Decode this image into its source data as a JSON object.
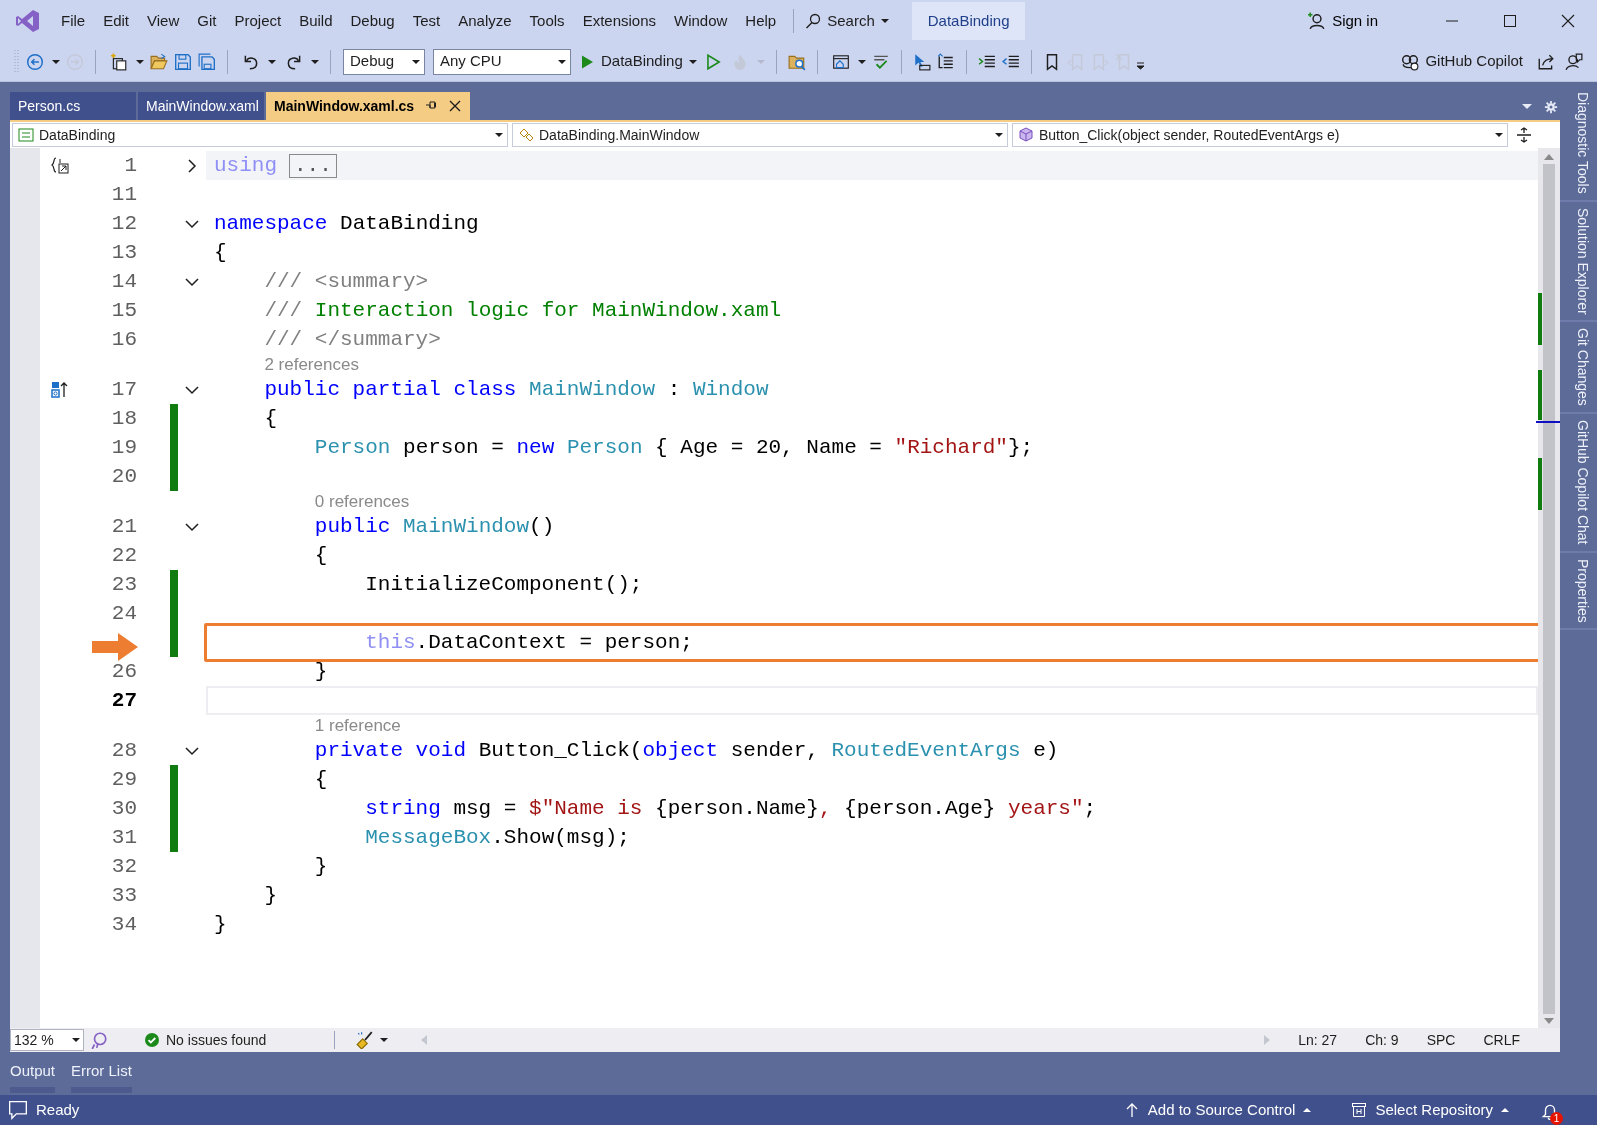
{
  "menu": [
    "File",
    "Edit",
    "View",
    "Git",
    "Project",
    "Build",
    "Debug",
    "Test",
    "Analyze",
    "Tools",
    "Extensions",
    "Window",
    "Help"
  ],
  "search": {
    "label": "Search"
  },
  "solution_title": "DataBinding",
  "sign_in": "Sign in",
  "toolbar": [
    {
      "kind": "back",
      "disabled": false
    },
    {
      "kind": "forward",
      "disabled": true
    },
    {
      "kind": "sep"
    },
    {
      "kind": "new-item",
      "disabled": false
    },
    {
      "kind": "open",
      "disabled": false
    },
    {
      "kind": "save",
      "disabled": false
    },
    {
      "kind": "save-all",
      "disabled": false
    },
    {
      "kind": "sep"
    },
    {
      "kind": "undo",
      "disabled": false
    },
    {
      "kind": "redo",
      "disabled": false
    },
    {
      "kind": "sep"
    },
    {
      "kind": "combo",
      "value": "Debug"
    },
    {
      "kind": "combo",
      "value": "Any CPU"
    },
    {
      "kind": "run",
      "label": "DataBinding"
    },
    {
      "kind": "run-outline",
      "disabled": false
    },
    {
      "kind": "hot-reload",
      "disabled": true
    },
    {
      "kind": "sep"
    },
    {
      "kind": "folder-search",
      "disabled": false
    },
    {
      "kind": "sep"
    },
    {
      "kind": "window",
      "disabled": false
    },
    {
      "kind": "spell",
      "disabled": false
    },
    {
      "kind": "sep"
    },
    {
      "kind": "cursor",
      "disabled": false
    },
    {
      "kind": "member-list",
      "disabled": false
    },
    {
      "kind": "sep"
    },
    {
      "kind": "indent",
      "disabled": false
    },
    {
      "kind": "outdent",
      "disabled": false
    },
    {
      "kind": "sep"
    },
    {
      "kind": "bookmark",
      "disabled": false
    },
    {
      "kind": "bookmark-prev",
      "disabled": true
    },
    {
      "kind": "bookmark-next",
      "disabled": true
    },
    {
      "kind": "bookmark-clear",
      "disabled": true
    },
    {
      "kind": "overflow"
    }
  ],
  "copilot": "GitHub Copilot",
  "tabs": [
    {
      "label": "Person.cs",
      "selected": false
    },
    {
      "label": "MainWindow.xaml",
      "selected": false
    },
    {
      "label": "MainWindow.xaml.cs",
      "selected": true
    }
  ],
  "nav_bar": {
    "project": "DataBinding",
    "type": "DataBinding.MainWindow",
    "member": "Button_Click(object sender, RoutedEventArgs e)"
  },
  "lines": [
    {
      "kind": "collapsed-usings",
      "number": "1",
      "expanded": false,
      "tokens": [
        {
          "text": "using",
          "kind": "dim"
        },
        {
          "text": "...",
          "kind": "fold-box"
        }
      ]
    },
    {
      "kind": "code",
      "number": "11"
    },
    {
      "kind": "code",
      "number": "12",
      "expanded": true,
      "tokens": [
        {
          "text": "namespace ",
          "kind": "keyword"
        },
        {
          "text": "DataBinding",
          "kind": "plain"
        }
      ]
    },
    {
      "kind": "code",
      "number": "13",
      "tokens": [
        {
          "text": "{",
          "kind": "plain"
        }
      ],
      "children": [
        {
          "kind": "code",
          "number": "14",
          "expanded": true,
          "tokens": [
            {
              "text": "/// <summary>",
              "kind": "doc"
            }
          ]
        },
        {
          "kind": "code",
          "number": "15",
          "tokens": [
            {
              "text": "/// ",
              "kind": "doc"
            },
            {
              "text": "Interaction logic for MainWindow.xaml",
              "kind": "comment"
            }
          ]
        },
        {
          "kind": "code",
          "number": "16",
          "tokens": [
            {
              "text": "/// </summary>",
              "kind": "doc"
            }
          ]
        },
        {
          "kind": "class-declaration",
          "codelens": "2 references",
          "number": "17",
          "expanded": true,
          "tokens": [
            {
              "text": "public partial class ",
              "kind": "keyword"
            },
            {
              "text": "MainWindow",
              "kind": "type"
            },
            {
              "text": " : ",
              "kind": "plain"
            },
            {
              "text": "Window",
              "kind": "type"
            }
          ]
        },
        {
          "kind": "code",
          "number": "18",
          "changed": true,
          "tokens": [
            {
              "text": "{",
              "kind": "plain"
            }
          ],
          "children": [
            {
              "kind": "code",
              "number": "19",
              "changed": true,
              "tokens": [
                {
                  "text": "Person",
                  "kind": "type"
                },
                {
                  "text": " person = ",
                  "kind": "plain"
                },
                {
                  "text": "new ",
                  "kind": "keyword"
                },
                {
                  "text": "Person",
                  "kind": "type"
                },
                {
                  "text": " { Age = 20, Name = ",
                  "kind": "plain"
                },
                {
                  "text": "\"Richard\"",
                  "kind": "string"
                },
                {
                  "text": "};",
                  "kind": "plain"
                }
              ]
            },
            {
              "kind": "code",
              "number": "20",
              "changed": true
            },
            {
              "kind": "code",
              "codelens": "0 references",
              "number": "21",
              "expanded": true,
              "tokens": [
                {
                  "text": "public ",
                  "kind": "keyword"
                },
                {
                  "text": "MainWindow",
                  "kind": "type"
                },
                {
                  "text": "()",
                  "kind": "plain"
                }
              ]
            },
            {
              "kind": "code",
              "number": "22",
              "tokens": [
                {
                  "text": "{",
                  "kind": "plain"
                }
              ],
              "children": [
                {
                  "kind": "code",
                  "number": "23",
                  "changed": true,
                  "tokens": [
                    {
                      "text": "InitializeComponent();",
                      "kind": "plain"
                    }
                  ]
                },
                {
                  "kind": "code",
                  "number": "24",
                  "changed": true
                },
                {
                  "kind": "code",
                  "changed": true,
                  "highlighted": true,
                  "tokens": [
                    {
                      "text": "this",
                      "kind": "dim"
                    },
                    {
                      "text": ".DataContext = person;",
                      "kind": "plain"
                    }
                  ]
                }
              ]
            },
            {
              "kind": "code",
              "number": "26",
              "tokens": [
                {
                  "text": "}",
                  "kind": "plain"
                }
              ]
            },
            {
              "kind": "code",
              "number": "27",
              "current": true
            },
            {
              "kind": "code",
              "codelens": "1 reference",
              "number": "28",
              "expanded": true,
              "tokens": [
                {
                  "text": "private void ",
                  "kind": "keyword"
                },
                {
                  "text": "Button_Click(",
                  "kind": "plain"
                },
                {
                  "text": "object",
                  "kind": "keyword"
                },
                {
                  "text": " sender, ",
                  "kind": "plain"
                },
                {
                  "text": "RoutedEventArgs",
                  "kind": "type"
                },
                {
                  "text": " e)",
                  "kind": "plain"
                }
              ]
            },
            {
              "kind": "code",
              "number": "29",
              "changed": true,
              "tokens": [
                {
                  "text": "{",
                  "kind": "plain"
                }
              ],
              "children": [
                {
                  "kind": "code",
                  "number": "30",
                  "changed": true,
                  "tokens": [
                    {
                      "text": "string",
                      "kind": "keyword"
                    },
                    {
                      "text": " msg = ",
                      "kind": "plain"
                    },
                    {
                      "text": "$\"Name is ",
                      "kind": "string"
                    },
                    {
                      "text": "{person.Name}",
                      "kind": "plain"
                    },
                    {
                      "text": ", ",
                      "kind": "string"
                    },
                    {
                      "text": "{person.Age}",
                      "kind": "plain"
                    },
                    {
                      "text": " years\"",
                      "kind": "string"
                    },
                    {
                      "text": ";",
                      "kind": "plain"
                    }
                  ]
                },
                {
                  "kind": "code",
                  "number": "31",
                  "changed": true,
                  "tokens": [
                    {
                      "text": "MessageBox",
                      "kind": "type"
                    },
                    {
                      "text": ".Show(msg);",
                      "kind": "plain"
                    }
                  ]
                }
              ]
            },
            {
              "kind": "code",
              "number": "32",
              "tokens": [
                {
                  "text": "}",
                  "kind": "plain"
                }
              ]
            }
          ]
        },
        {
          "kind": "code",
          "number": "33",
          "tokens": [
            {
              "text": "}",
              "kind": "plain"
            }
          ]
        }
      ]
    },
    {
      "kind": "code",
      "number": "34",
      "tokens": [
        {
          "text": "}",
          "kind": "plain"
        }
      ]
    }
  ],
  "editor_footer": {
    "zoom": "132 %",
    "issues": "No issues found",
    "position": [
      "Ln: 27",
      "Ch: 9",
      "SPC",
      "CRLF"
    ]
  },
  "side_tabs": [
    "Diagnostic Tools",
    "Solution Explorer",
    "Git Changes",
    "GitHub Copilot Chat",
    "Properties"
  ],
  "panel_tabs": [
    "Output",
    "Error List"
  ],
  "status_bar": {
    "state": "Ready",
    "source_control": "Add to Source Control",
    "repository": "Select Repository",
    "notifications": "1"
  }
}
